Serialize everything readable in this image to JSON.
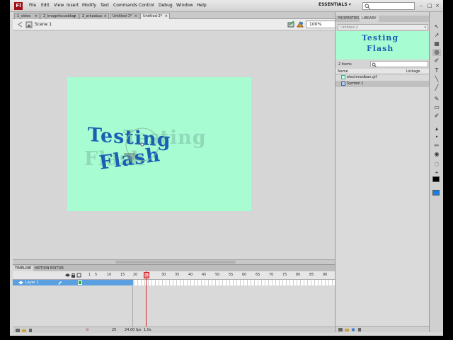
{
  "app": {
    "logo": "Fl"
  },
  "menu": [
    "File",
    "Edit",
    "View",
    "Insert",
    "Modify",
    "Text",
    "Commands",
    "Control",
    "Debug",
    "Window",
    "Help"
  ],
  "workspace": {
    "label": "ESSENTIALS",
    "chevron": "▾"
  },
  "window_controls": [
    "–",
    "□",
    "×"
  ],
  "doc_tabs": [
    {
      "label": "1_video",
      "active": false
    },
    {
      "label": "2_imagefocusblog",
      "active": false
    },
    {
      "label": "2_arkasbus",
      "active": false
    },
    {
      "label": "Untitled-1*",
      "active": false
    },
    {
      "label": "Untitled-2*",
      "active": true
    }
  ],
  "tab_close": "×",
  "editbar": {
    "scene": "Scene 1",
    "zoom": "100%"
  },
  "stage": {
    "line1": "Testing",
    "line2": "Flash",
    "background": "#a7fcd2",
    "text_color": "#1b5fb4"
  },
  "timeline": {
    "tabs": [
      "TIMELINE",
      "MOTION EDITOR"
    ],
    "frame_numbers": [
      "1",
      "5",
      "10",
      "15",
      "20",
      "25",
      "30",
      "35",
      "40",
      "45",
      "50",
      "55",
      "60",
      "65",
      "70",
      "75",
      "80",
      "85",
      "90",
      "9"
    ],
    "playhead": "25",
    "layer_name": "Layer 1",
    "footer": {
      "frame": "25",
      "fps": "24.00 fps",
      "time": "1.0s"
    }
  },
  "panel": {
    "tabs": [
      "PROPERTIES",
      "LIBRARY"
    ],
    "document": "Untitled-2",
    "item_count": "2 items",
    "columns": [
      "Name",
      "Linkage"
    ],
    "items": [
      {
        "name": "etechmodban.gif",
        "type": "bitmap",
        "selected": false
      },
      {
        "name": "Symbol 1",
        "type": "movieclip",
        "selected": true
      }
    ]
  },
  "tools": [
    "↖",
    "↗",
    "▦",
    "◍",
    "✐",
    "T",
    "╲",
    "╱",
    "✎",
    "▭",
    "✐",
    "▴",
    "•",
    "✏",
    "◉",
    "◌",
    "⌖"
  ],
  "colors": {
    "stroke": "#000000",
    "fill": "#1a7fe0",
    "accent": "#5a9fe0",
    "playhead": "#dd2222"
  }
}
